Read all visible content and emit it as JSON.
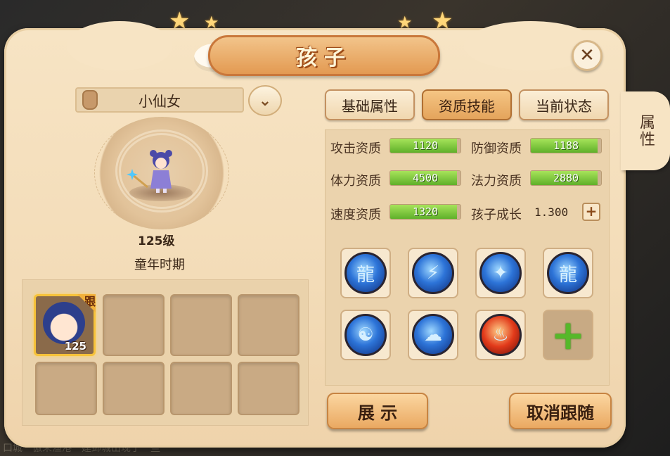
{
  "window": {
    "title": "孩子",
    "close_label": "✕",
    "side_tab": "属性"
  },
  "child": {
    "name": "小仙女",
    "level": "125级",
    "period": "童年时期"
  },
  "slots": {
    "selected_badge": "跟",
    "selected_level": "125"
  },
  "tabs": [
    {
      "label": "基础属性"
    },
    {
      "label": "资质技能"
    },
    {
      "label": "当前状态"
    }
  ],
  "attributes": [
    {
      "label": "攻击资质",
      "value": "1120",
      "fill": 0.95
    },
    {
      "label": "防御资质",
      "value": "1188",
      "fill": 0.95
    },
    {
      "label": "体力资质",
      "value": "4500",
      "fill": 0.95
    },
    {
      "label": "法力资质",
      "value": "2880",
      "fill": 0.95
    },
    {
      "label": "速度资质",
      "value": "1320",
      "fill": 0.95
    }
  ],
  "growth": {
    "label": "孩子成长",
    "value": "1.300",
    "plus": "+"
  },
  "skills": [
    {
      "icon": "blue-dragon-icon",
      "glyph": "龍"
    },
    {
      "icon": "lightning-claw-icon",
      "glyph": "⚡"
    },
    {
      "icon": "water-warrior-icon",
      "glyph": "✦"
    },
    {
      "icon": "white-dragon-icon",
      "glyph": "龍"
    },
    {
      "icon": "dragon-head-icon",
      "glyph": "☯"
    },
    {
      "icon": "cloud-icon",
      "glyph": "☁"
    },
    {
      "icon": "red-fiend-icon",
      "glyph": "♨"
    }
  ],
  "add_skill": "+",
  "buttons": {
    "show": "展 示",
    "cancel_follow": "取消跟随"
  },
  "background_text": "口城　傲来渔港　建邺城出现了一些",
  "colors": {
    "panel": "#f7e4c4",
    "bar_green": "#5fb02a",
    "accent_orange": "#e39a52"
  }
}
